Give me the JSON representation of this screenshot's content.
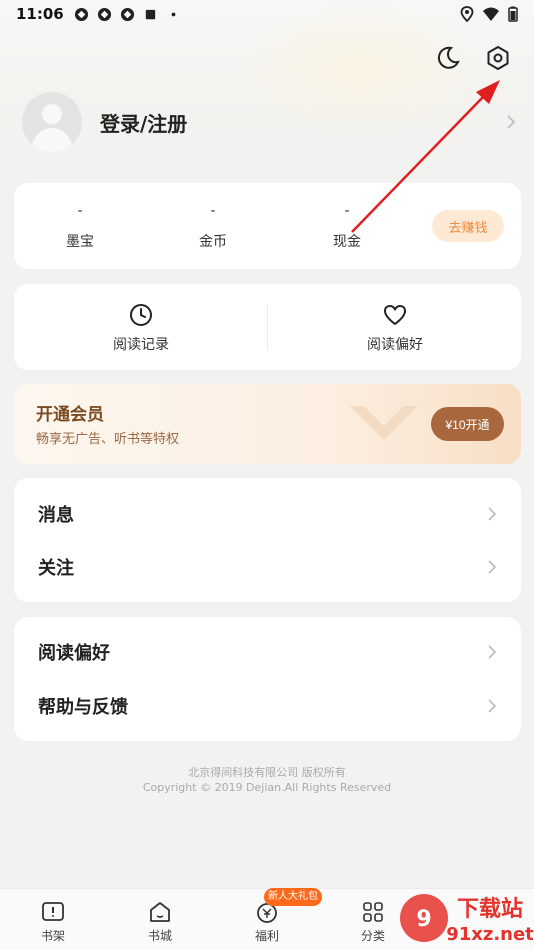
{
  "status_bar": {
    "time": "11:06"
  },
  "profile": {
    "login_label": "登录/注册"
  },
  "stats": [
    {
      "value": "-",
      "label": "墨宝"
    },
    {
      "value": "-",
      "label": "金币"
    },
    {
      "value": "-",
      "label": "现金"
    }
  ],
  "earn_button": "去赚钱",
  "quick": [
    {
      "label": "阅读记录",
      "icon": "clock-icon"
    },
    {
      "label": "阅读偏好",
      "icon": "heart-icon"
    }
  ],
  "vip": {
    "title": "开通会员",
    "subtitle": "畅享无广告、听书等特权",
    "button": "¥10开通"
  },
  "menu_group_1": [
    {
      "label": "消息"
    },
    {
      "label": "关注"
    }
  ],
  "menu_group_2": [
    {
      "label": "阅读偏好"
    },
    {
      "label": "帮助与反馈"
    }
  ],
  "footer": {
    "line1": "北京得间科技有限公司 版权所有",
    "line2": "Copyright © 2019 Dejian.All Rights Reserved"
  },
  "tabs": [
    {
      "label": "书架",
      "icon": "bookshelf-icon"
    },
    {
      "label": "书城",
      "icon": "home-icon"
    },
    {
      "label": "福利",
      "icon": "coin-icon"
    },
    {
      "label": "分类",
      "icon": "grid-icon"
    }
  ],
  "tab_badge": "新人大礼包",
  "watermark": {
    "text1": "下载站",
    "text2": "91xz.net"
  },
  "colors": {
    "accent": "#f08a3c",
    "vip": "#a8673c",
    "arrow": "#e02020"
  }
}
